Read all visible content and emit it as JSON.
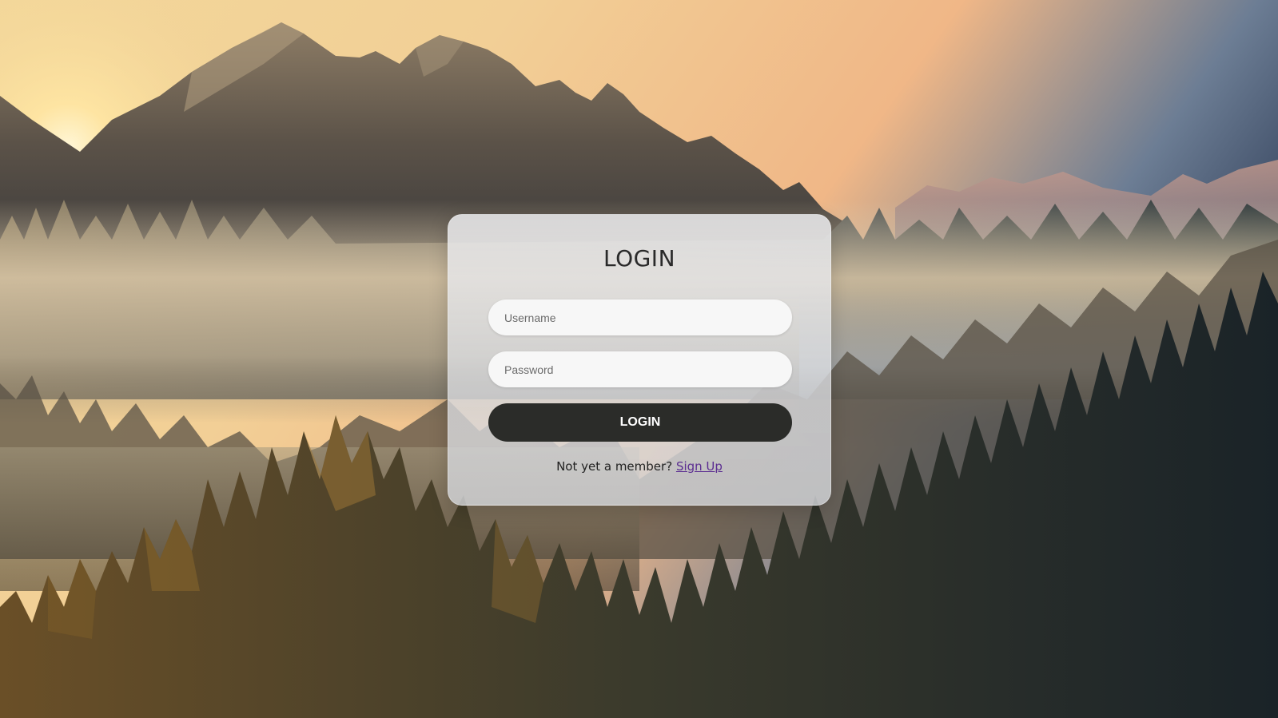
{
  "login_card": {
    "title": "LOGIN",
    "username_placeholder": "Username",
    "password_placeholder": "Password",
    "submit_label": "LOGIN",
    "signup_prompt": "Not yet a member?",
    "signup_link": "Sign Up"
  },
  "colors": {
    "button_bg": "#2b2c29",
    "button_text": "#ffffff",
    "link": "#5b2d91"
  }
}
